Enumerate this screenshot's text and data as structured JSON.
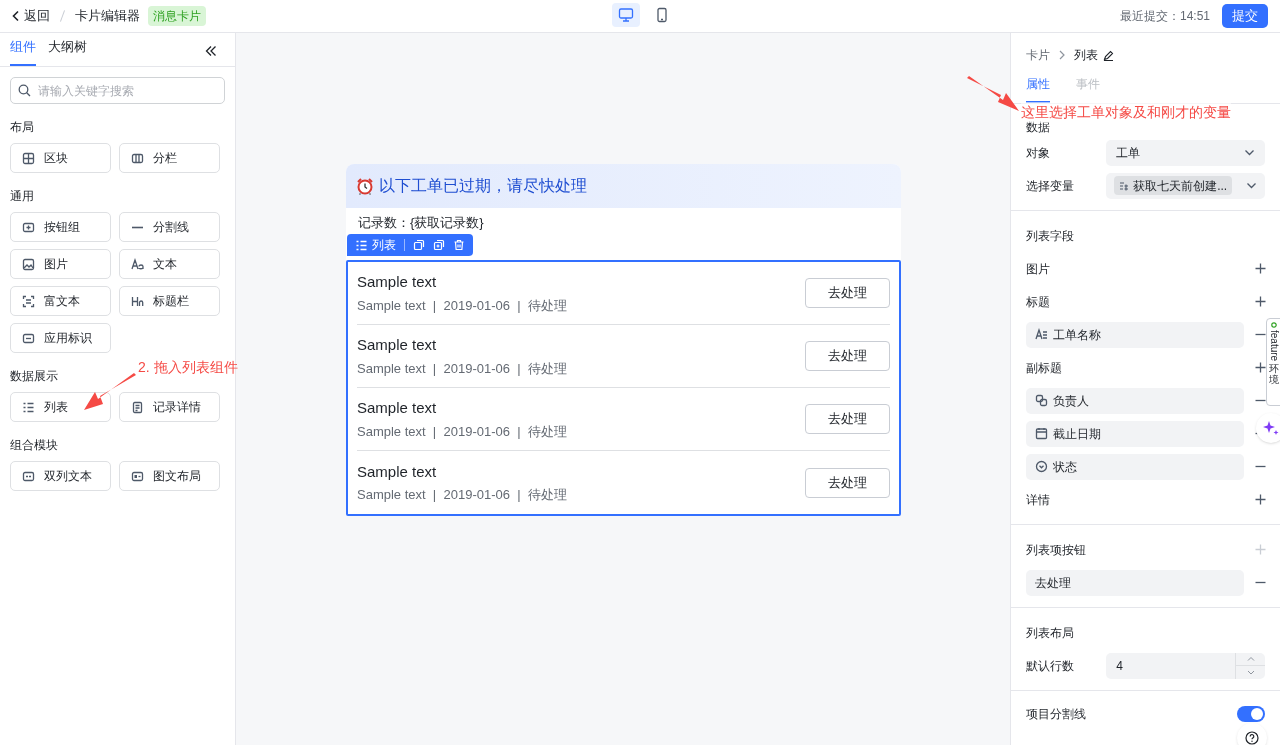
{
  "topbar": {
    "back": "返回",
    "breadcrumb": "卡片编辑器",
    "tag": "消息卡片",
    "devices": [
      {
        "kind": "desktop",
        "selected": true
      },
      {
        "kind": "mobile",
        "selected": false
      }
    ],
    "last_submit": "最近提交：14:51",
    "submit": "提交"
  },
  "sidebar": {
    "tabs": [
      {
        "label": "组件",
        "selected": true
      },
      {
        "label": "大纲树",
        "selected": false
      }
    ],
    "search": {
      "placeholder": "请输入关键字搜索"
    },
    "groups": [
      {
        "title": "布局",
        "items": [
          {
            "label": "区块",
            "kind": "grid"
          },
          {
            "label": "分栏",
            "kind": "columns"
          }
        ]
      },
      {
        "title": "通用",
        "items": [
          {
            "label": "按钮组",
            "kind": "button"
          },
          {
            "label": "分割线",
            "kind": "divider"
          },
          {
            "label": "图片",
            "kind": "image"
          },
          {
            "label": "文本",
            "kind": "text"
          },
          {
            "label": "富文本",
            "kind": "richtext"
          },
          {
            "label": "标题栏",
            "kind": "heading"
          },
          {
            "label": "应用标识",
            "kind": "app"
          }
        ]
      },
      {
        "title": "数据展示",
        "items": [
          {
            "label": "列表",
            "kind": "list"
          },
          {
            "label": "记录详情",
            "kind": "detail"
          }
        ]
      },
      {
        "title": "组合模块",
        "items": [
          {
            "label": "双列文本",
            "kind": "twocol"
          },
          {
            "label": "图文布局",
            "kind": "media"
          }
        ]
      }
    ]
  },
  "annotations": [
    {
      "text": "2. 拖入列表组件"
    },
    {
      "text": "这里选择工单对象及和刚才的变量"
    }
  ],
  "card": {
    "title": "以下工单已过期，请尽快处理",
    "record_count": "记录数：{获取记录数}",
    "toolbar_label": "列表",
    "rows": [
      {
        "title": "Sample text",
        "subtitle": "Sample text  |  2019-01-06  |  待处理",
        "button": "去处理"
      },
      {
        "title": "Sample text",
        "subtitle": "Sample text  |  2019-01-06  |  待处理",
        "button": "去处理"
      },
      {
        "title": "Sample text",
        "subtitle": "Sample text  |  2019-01-06  |  待处理",
        "button": "去处理"
      },
      {
        "title": "Sample text",
        "subtitle": "Sample text  |  2019-01-06  |  待处理",
        "button": "去处理"
      }
    ]
  },
  "panel": {
    "breadcrumb": [
      "卡片",
      "列表"
    ],
    "tabs": [
      {
        "label": "属性",
        "selected": true
      },
      {
        "label": "事件",
        "selected": false
      }
    ],
    "data": {
      "title": "数据",
      "object": {
        "label": "对象",
        "value": "工单"
      },
      "variable": {
        "label": "选择变量",
        "value": "获取七天前创建..."
      }
    },
    "list_fields": {
      "title": "列表字段",
      "groups": [
        {
          "label": "图片"
        },
        {
          "label": "标题",
          "items": [
            {
              "label": "工单名称",
              "kind": "text"
            }
          ]
        },
        {
          "label": "副标题",
          "items": [
            {
              "label": "负责人",
              "kind": "person"
            },
            {
              "label": "截止日期",
              "kind": "date"
            },
            {
              "label": "状态",
              "kind": "status"
            }
          ]
        },
        {
          "label": "详情"
        }
      ]
    },
    "item_buttons": {
      "title": "列表项按钮",
      "disabled": true,
      "items": [
        {
          "label": "去处理"
        }
      ]
    },
    "layout": {
      "title": "列表布局",
      "rows_label": "默认行数",
      "rows_value": "4"
    },
    "divider_setting": {
      "label": "项目分割线",
      "on": true
    }
  },
  "feature_tab": {
    "label": "feature",
    "label2": "环境"
  }
}
